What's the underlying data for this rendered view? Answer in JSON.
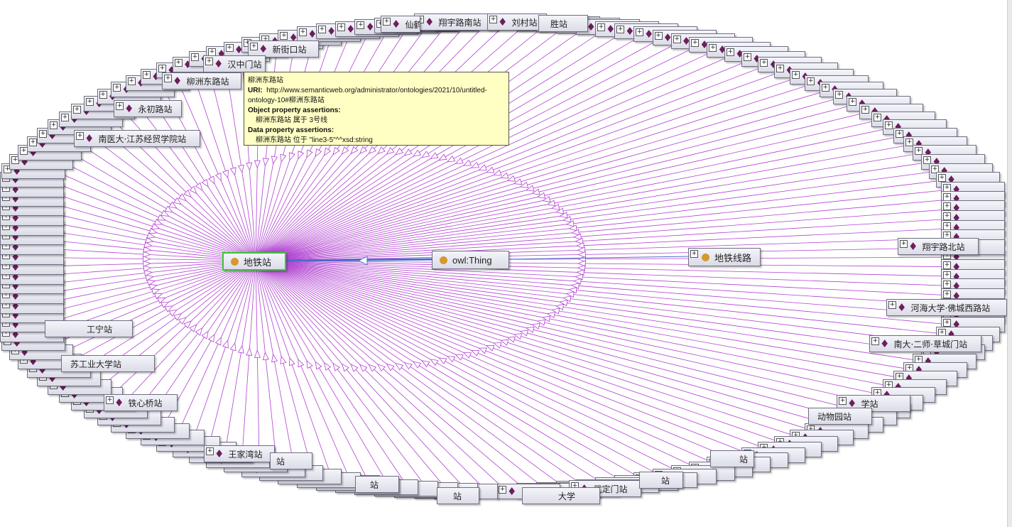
{
  "colors": {
    "edge": "#b040d0",
    "arrow": "#b040d0",
    "thing_edge": "#4a6cc8",
    "diamond": "#6b1f5c",
    "class_dot": "#d49a2e",
    "selected_border": "#2ecc2e",
    "tooltip_bg": "#ffffc4"
  },
  "icons": {
    "individual": "diamond-icon",
    "class": "circle-icon",
    "expand": "plus-icon"
  },
  "classes": {
    "center": "地铁站",
    "thing": "owl:Thing",
    "line": "地铁线路"
  },
  "tooltip": {
    "title": "柳洲东路站",
    "uri_label": "URI:",
    "uri_value": "http://www.semanticweb.org/administrator/ontologies/2021/10/untitled-ontology-10#柳洲东路站",
    "obj_heading": "Object property assertions:",
    "obj_value": "柳洲东路站 属于 3号线",
    "data_heading": "Data property assertions:",
    "data_value": "柳洲东路站 位于 \"line3-5\"^^xsd:string"
  },
  "individuals": [
    "翔宇路南站",
    "刘村站",
    "仙鹤",
    "胜站",
    "新街口站",
    "汉中门站",
    "柳洲东路站",
    "永初路站",
    "南医大·江苏经贸学院站",
    "翔宇路北站",
    "河海大学·佛城西路站",
    "南大·二师·草城门站",
    "学站",
    "铁心桥站",
    "王家湾站",
    "武定门站",
    "动物园站",
    "站",
    "站",
    "站",
    "站",
    "站",
    "工宁站",
    "苏工业大学站",
    "大学"
  ]
}
